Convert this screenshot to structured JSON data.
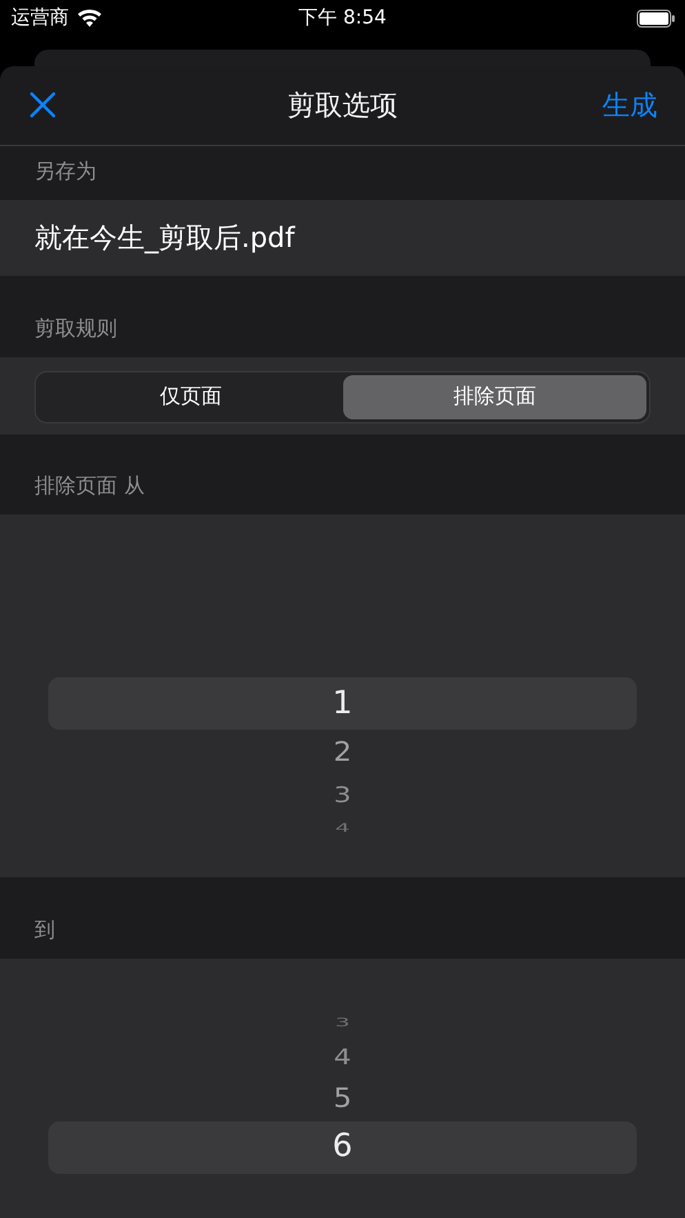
{
  "status_bar": {
    "carrier": "运营商",
    "time": "下午 8:54"
  },
  "nav": {
    "title": "剪取选项",
    "action": "生成"
  },
  "save_as": {
    "header": "另存为",
    "value": "就在今生_剪取后.pdf"
  },
  "rule": {
    "header": "剪取规则",
    "segments": [
      {
        "label": "仅页面",
        "selected": false
      },
      {
        "label": "排除页面",
        "selected": true
      }
    ]
  },
  "from_picker": {
    "header": "排除页面 从",
    "items": [
      {
        "text": "1",
        "selected": true
      },
      {
        "text": "2",
        "selected": false
      },
      {
        "text": "3",
        "selected": false
      },
      {
        "text": "4",
        "selected": false
      }
    ]
  },
  "to_picker": {
    "header": "到",
    "items": [
      {
        "text": "3",
        "selected": false
      },
      {
        "text": "4",
        "selected": false
      },
      {
        "text": "5",
        "selected": false
      },
      {
        "text": "6",
        "selected": true
      }
    ]
  }
}
